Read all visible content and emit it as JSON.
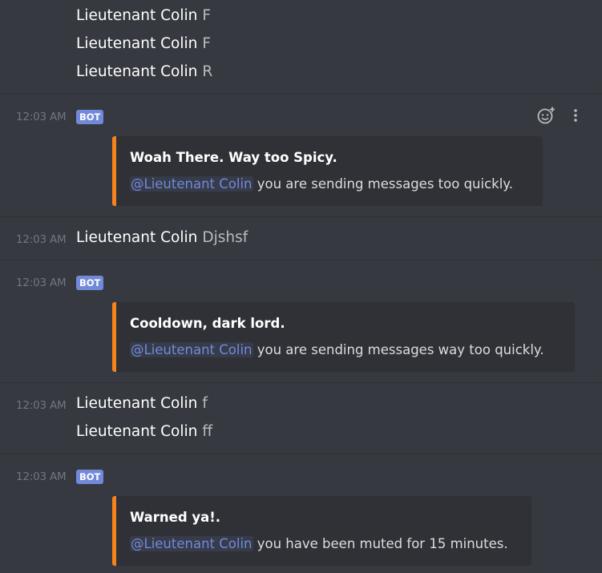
{
  "messages": {
    "top_lines": [
      {
        "author": "Lieutenant Colin",
        "text": "F"
      },
      {
        "author": "Lieutenant Colin",
        "text": "F"
      },
      {
        "author": "Lieutenant Colin",
        "text": "R"
      }
    ],
    "bot1": {
      "time": "12:03 AM",
      "badge": "BOT",
      "embed_title": "Woah There. Way too Spicy.",
      "mention": "@Lieutenant Colin",
      "embed_desc": "you are sending messages too quickly."
    },
    "user2": {
      "time": "12:03 AM",
      "author": "Lieutenant Colin",
      "text": "Djshsf"
    },
    "bot2": {
      "time": "12:03 AM",
      "badge": "BOT",
      "embed_title": "Cooldown, dark lord.",
      "mention": "@Lieutenant Colin",
      "embed_desc": "you are sending messages way too quickly."
    },
    "user3": {
      "time": "12:03 AM",
      "lines": [
        {
          "author": "Lieutenant Colin",
          "text": "f"
        },
        {
          "author": "Lieutenant Colin",
          "text": "ff"
        }
      ]
    },
    "bot3": {
      "time": "12:03 AM",
      "badge": "BOT",
      "embed_title": "Warned ya!.",
      "mention": "@Lieutenant Colin",
      "embed_desc": "you have been muted for 15 minutes."
    }
  },
  "icons": {
    "add_reaction": "add-reaction-icon",
    "more": "more-options-icon"
  },
  "colors": {
    "background": "#36393f",
    "embed_background": "#2f3136",
    "embed_accent": "#f6831b",
    "bot_badge": "#7289da",
    "mention": "#7289da"
  }
}
